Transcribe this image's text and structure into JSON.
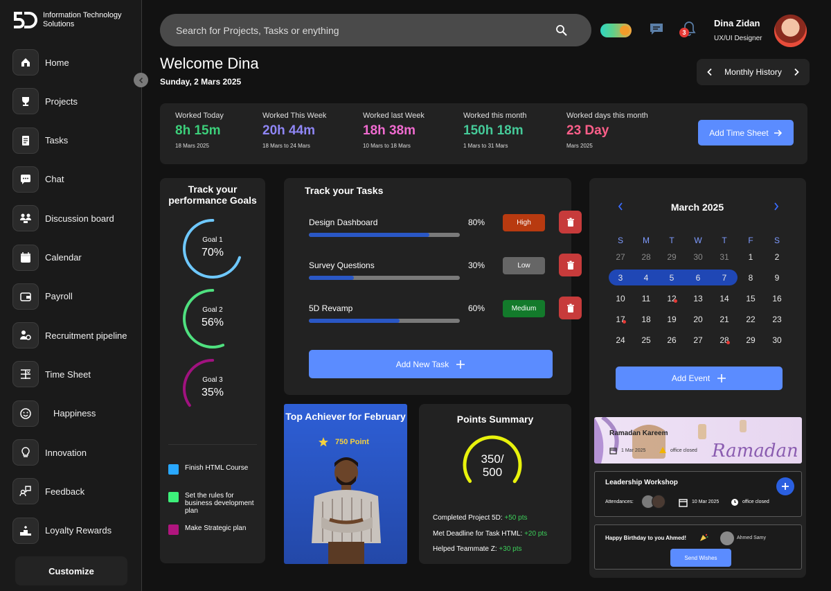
{
  "brand": {
    "name": "Information Technology Solutions",
    "logo_text": "5D"
  },
  "sidebar": {
    "items": [
      {
        "label": "Home",
        "icon": "home-icon"
      },
      {
        "label": "Projects",
        "icon": "trophy-icon"
      },
      {
        "label": "Tasks",
        "icon": "clipboard-icon"
      },
      {
        "label": "Chat",
        "icon": "chat-bubble-icon"
      },
      {
        "label": "Discussion board",
        "icon": "users-icon"
      },
      {
        "label": "Calendar",
        "icon": "calendar-icon"
      },
      {
        "label": "Payroll",
        "icon": "wallet-icon"
      },
      {
        "label": "Recruitment pipeline",
        "icon": "user-gear-icon"
      },
      {
        "label": "Time Sheet",
        "icon": "timesheet-icon"
      },
      {
        "label": "Happiness",
        "icon": "smile-icon"
      },
      {
        "label": "Innovation",
        "icon": "lightbulb-icon"
      },
      {
        "label": "Feedback",
        "icon": "feedback-icon"
      },
      {
        "label": "Loyalty Rewards",
        "icon": "podium-icon"
      }
    ],
    "customize_label": "Customize"
  },
  "header": {
    "search_placeholder": "Search for Projects, Tasks or enything",
    "notification_count": "3",
    "user_name": "Dina Zidan",
    "user_role": "UX/UI Designer"
  },
  "welcome": {
    "title": "Welcome Dina",
    "date": "Sunday, 2 Mars 2025"
  },
  "history_label": "Monthly History",
  "stats": [
    {
      "label": "Worked Today",
      "value": "8h 15m",
      "range": "18 Mars 2025",
      "color": "#3ccf7a"
    },
    {
      "label": "Worked This Week",
      "value": "20h 44m",
      "range": "18 Mars to 24 Mars",
      "color": "#8f86f5"
    },
    {
      "label": "Worked last Week",
      "value": "18h 38m",
      "range": "10 Mars to 18 Mars",
      "color": "#f06bd0"
    },
    {
      "label": "Worked this month",
      "value": "150h 18m",
      "range": "1 Mars to 31 Mars",
      "color": "#45c998"
    },
    {
      "label": "Worked days this month",
      "value": "23 Day",
      "range": "Mars 2025",
      "color": "#ff5f8a"
    }
  ],
  "add_timesheet_label": "Add Time Sheet",
  "goals": {
    "title": "Track your performance Goals",
    "items": [
      {
        "name": "Goal 1",
        "pct": "70%",
        "value": 0.7,
        "color": "#6ec8ff"
      },
      {
        "name": "Goal 2",
        "pct": "56%",
        "value": 0.56,
        "color": "#4fe07f"
      },
      {
        "name": "Goal 3",
        "pct": "35%",
        "value": 0.35,
        "color": "#a0127f"
      }
    ],
    "legend": [
      {
        "label": "Finish HTML Course",
        "color": "#29a8ff"
      },
      {
        "label": "Set the rules for business development plan",
        "color": "#3df07a"
      },
      {
        "label": "Make Strategic plan",
        "color": "#b0157e"
      }
    ]
  },
  "tasks": {
    "title": "Track your Tasks",
    "items": [
      {
        "name": "Design Dashboard",
        "pct": "80%",
        "value": 0.8,
        "priority": "High",
        "prio_color": "#b83a10"
      },
      {
        "name": "Survey Questions",
        "pct": "30%",
        "value": 0.3,
        "priority": "Low",
        "prio_color": "#666666"
      },
      {
        "name": "5D Revamp",
        "pct": "60%",
        "value": 0.6,
        "priority": "Medium",
        "prio_color": "#137a2b"
      }
    ],
    "add_label": "Add New Task"
  },
  "calendar": {
    "month": "March 2025",
    "dow": [
      "S",
      "M",
      "T",
      "W",
      "T",
      "F",
      "S"
    ],
    "weeks": [
      [
        "27",
        "28",
        "29",
        "30",
        "31",
        "1",
        "2"
      ],
      [
        "3",
        "4",
        "5",
        "6",
        "7",
        "8",
        "9"
      ],
      [
        "10",
        "11",
        "12",
        "13",
        "14",
        "15",
        "16"
      ],
      [
        "17",
        "18",
        "19",
        "20",
        "21",
        "22",
        "23"
      ],
      [
        "24",
        "25",
        "26",
        "27",
        "28",
        "29",
        "30"
      ]
    ],
    "add_event_label": "Add Event"
  },
  "achiever": {
    "title": "Top Achiever for February",
    "points": "750 Point"
  },
  "points": {
    "title": "Points Summary",
    "value": "350/",
    "total": "500",
    "progress": 0.7,
    "items": [
      {
        "text": "Completed Project 5D:",
        "pts": "+50 pts"
      },
      {
        "text": "Met Deadline for Task HTML:",
        "pts": "+20 pts"
      },
      {
        "text": "Helped Teammate Z:",
        "pts": "+30 pts"
      }
    ]
  },
  "events": {
    "ramadan": {
      "title": "Ramadan Kareem",
      "date": "1 Mar 2025",
      "status": "office closed",
      "art_text": "Ramadan"
    },
    "workshop": {
      "title": "Leadership Workshop",
      "attend_label": "Attendances:",
      "date": "10 Mar 2025",
      "status": "office closed"
    },
    "birthday": {
      "title": "Happy Birthday to you Ahmed!",
      "person": "Ahmed Samy",
      "button": "Send Wishes"
    }
  }
}
